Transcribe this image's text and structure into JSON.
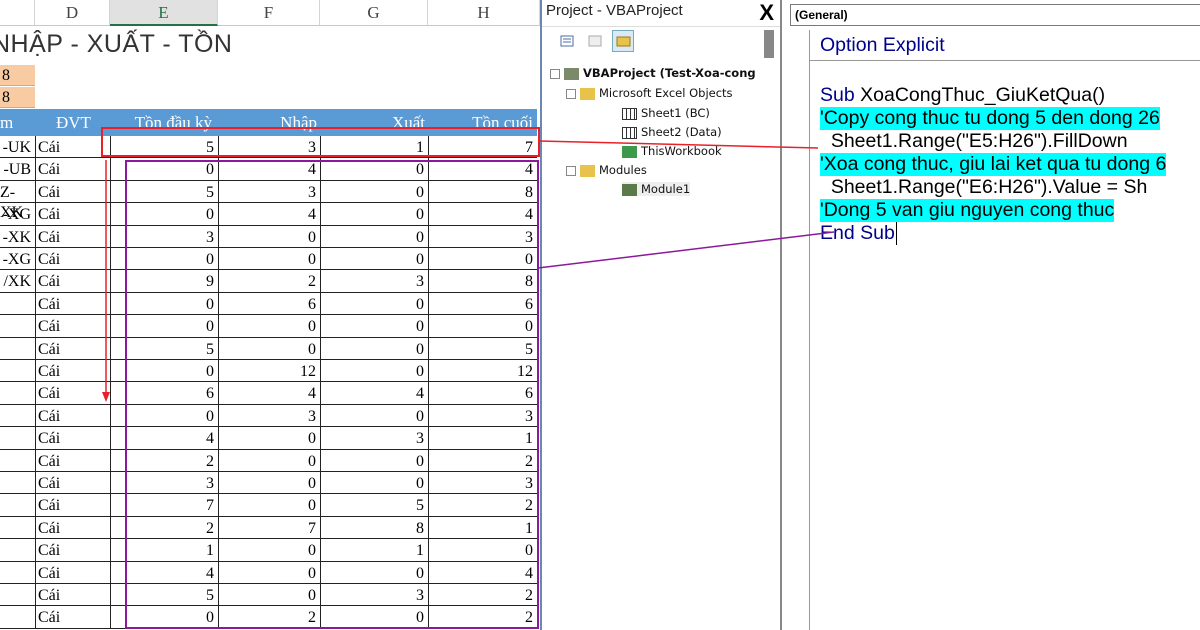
{
  "sheet": {
    "columns": [
      "D",
      "E",
      "F",
      "G",
      "H"
    ],
    "title": "NHẬP - XUẤT - TỒN",
    "orange_cells": [
      "8",
      "8"
    ],
    "headers": {
      "a": "m",
      "dvt": "ĐVT",
      "ton_dau": "Tồn đầu kỳ",
      "nhap": "Nhập",
      "xuat": "Xuất",
      "ton_cuoi": "Tồn cuối"
    },
    "rows": [
      [
        "-UK",
        "Cái",
        "5",
        "3",
        "1",
        "7"
      ],
      [
        "-UB",
        "Cái",
        "0",
        "4",
        "0",
        "4"
      ],
      [
        "Z-XK",
        "Cái",
        "5",
        "3",
        "0",
        "8"
      ],
      [
        "-XG",
        "Cái",
        "0",
        "4",
        "0",
        "4"
      ],
      [
        "-XK",
        "Cái",
        "3",
        "0",
        "0",
        "3"
      ],
      [
        "-XG",
        "Cái",
        "0",
        "0",
        "0",
        "0"
      ],
      [
        "/XK",
        "Cái",
        "9",
        "2",
        "3",
        "8"
      ],
      [
        "",
        "Cái",
        "0",
        "6",
        "0",
        "6"
      ],
      [
        "",
        "Cái",
        "0",
        "0",
        "0",
        "0"
      ],
      [
        "",
        "Cái",
        "5",
        "0",
        "0",
        "5"
      ],
      [
        "",
        "Cái",
        "0",
        "12",
        "0",
        "12"
      ],
      [
        "",
        "Cái",
        "6",
        "4",
        "4",
        "6"
      ],
      [
        "",
        "Cái",
        "0",
        "3",
        "0",
        "3"
      ],
      [
        "",
        "Cái",
        "4",
        "0",
        "3",
        "1"
      ],
      [
        "",
        "Cái",
        "2",
        "0",
        "0",
        "2"
      ],
      [
        "",
        "Cái",
        "3",
        "0",
        "0",
        "3"
      ],
      [
        "",
        "Cái",
        "7",
        "0",
        "5",
        "2"
      ],
      [
        "",
        "Cái",
        "2",
        "7",
        "8",
        "1"
      ],
      [
        "",
        "Cái",
        "1",
        "0",
        "1",
        "0"
      ],
      [
        "",
        "Cái",
        "4",
        "0",
        "0",
        "4"
      ],
      [
        "",
        "Cái",
        "5",
        "0",
        "3",
        "2"
      ],
      [
        "",
        "Cái",
        "0",
        "2",
        "0",
        "2"
      ]
    ]
  },
  "project": {
    "title": "Project - VBAProject",
    "close": "X",
    "root": "VBAProject (Test-Xoa-cong",
    "folder1": "Microsoft Excel Objects",
    "items": [
      "Sheet1 (BC)",
      "Sheet2 (Data)",
      "ThisWorkbook"
    ],
    "folder2": "Modules",
    "module": "Module1"
  },
  "code": {
    "combo": "(General)",
    "lines": [
      "Option Explicit",
      "Sub ",
      "XoaCongThuc_GiuKetQua()",
      "'Copy cong thuc tu dong 5 den dong 26",
      "  Sheet1.Range(\"E5:H26\").FillDown",
      "'Xoa cong thuc, giu lai ket qua tu dong 6",
      "  Sheet1.Range(\"E6:H26\").Value = Sh",
      "'Dong 5 van giu nguyen cong thuc",
      "End Sub"
    ]
  },
  "colors": {
    "red": "#e8202a",
    "purple": "#8b1a9b",
    "cyan": "#00ffff",
    "header_blue": "#5b9bd5"
  }
}
